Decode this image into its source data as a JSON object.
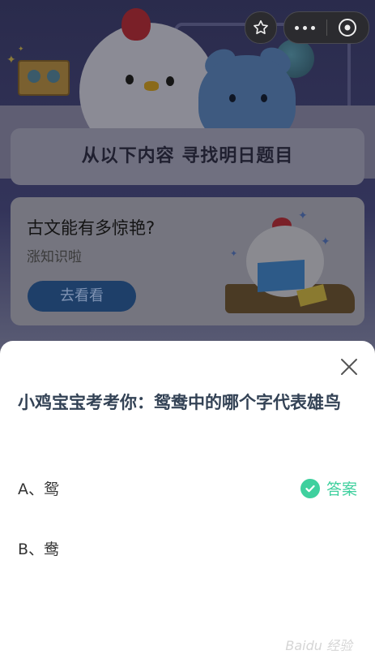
{
  "header": {
    "title": "从以下内容 寻找明日题目"
  },
  "article": {
    "title": "古文能有多惊艳?",
    "subtitle": "涨知识啦",
    "button_label": "去看看"
  },
  "top_buttons": {
    "favorite_icon": "star-icon",
    "more_icon": "more-dots-icon",
    "close_icon": "close-circle-icon"
  },
  "quiz": {
    "question": "小鸡宝宝考考你：鸳鸯中的哪个字代表雄鸟",
    "options": [
      {
        "label": "A、鸳",
        "is_answer": true
      },
      {
        "label": "B、鸯",
        "is_answer": false
      }
    ],
    "answer_label": "答案",
    "accent_color": "#3fd09e"
  },
  "watermark": "Baidu 经验"
}
